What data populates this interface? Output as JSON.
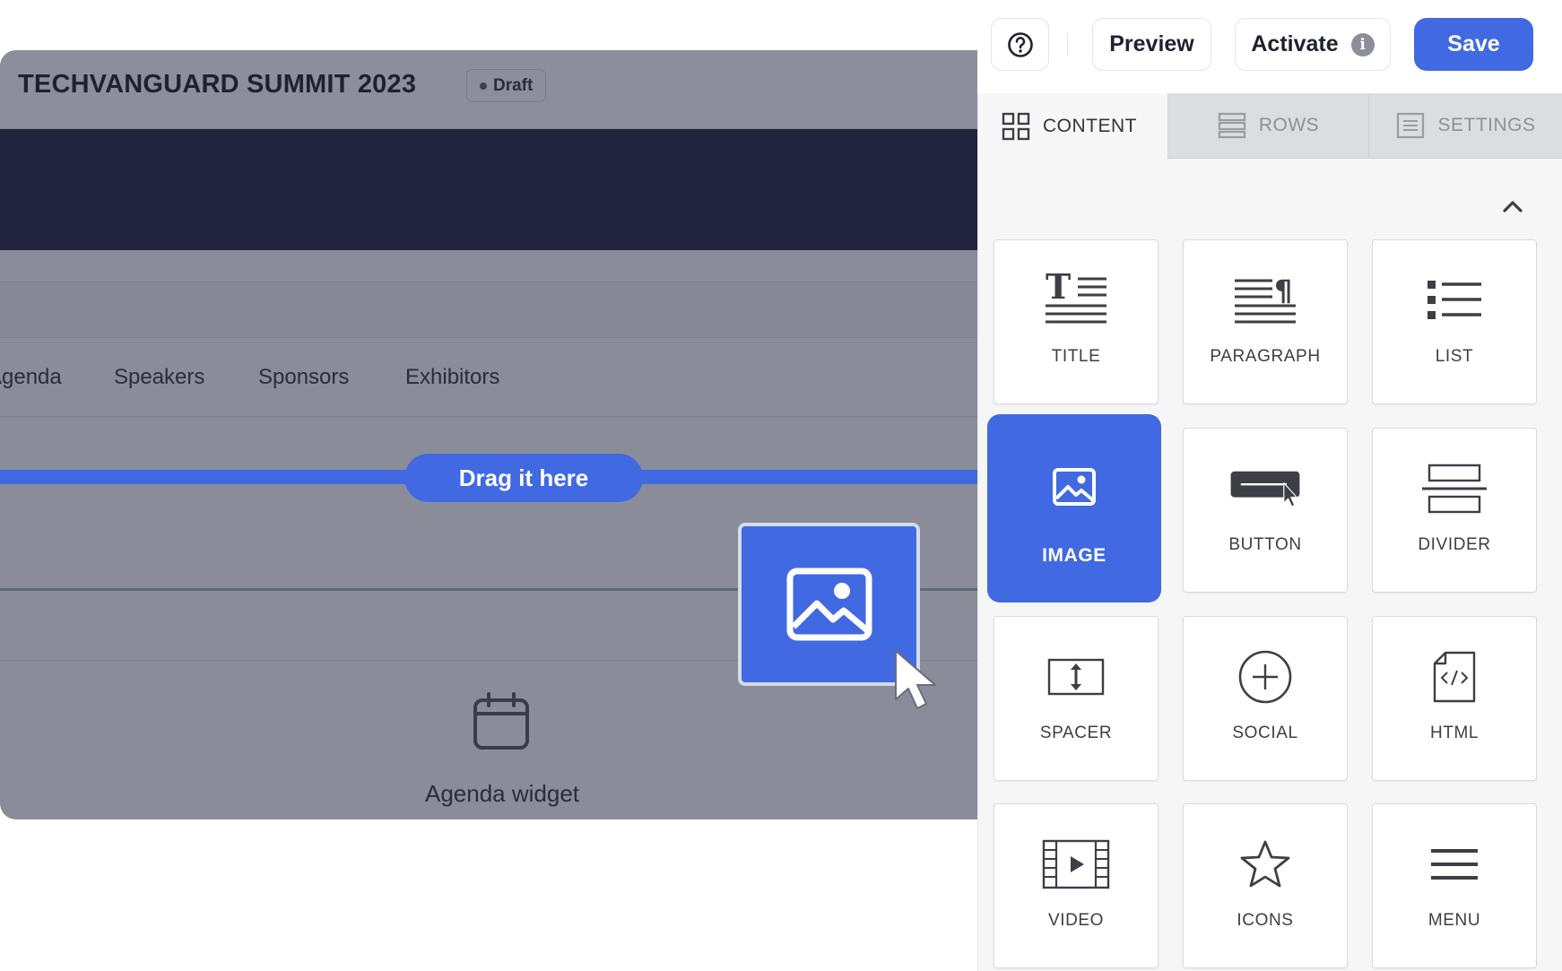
{
  "canvas": {
    "title": "TECHVANGUARD SUMMIT 2023",
    "status": "Draft",
    "nav": [
      "Agenda",
      "Speakers",
      "Sponsors",
      "Exhibitors"
    ],
    "drop_hint": "Drag it here",
    "agenda_widget_label": "Agenda widget"
  },
  "topbar": {
    "preview_label": "Preview",
    "activate_label": "Activate",
    "info_glyph": "i",
    "save_label": "Save"
  },
  "panel": {
    "tabs": [
      {
        "label": "CONTENT",
        "icon": "grid-icon",
        "active": true
      },
      {
        "label": "ROWS",
        "icon": "rows-icon",
        "active": false
      },
      {
        "label": "SETTINGS",
        "icon": "settings-list-icon",
        "active": false
      }
    ],
    "tiles": [
      {
        "label": "TITLE",
        "icon": "title-icon"
      },
      {
        "label": "PARAGRAPH",
        "icon": "paragraph-icon"
      },
      {
        "label": "LIST",
        "icon": "list-icon"
      },
      {
        "label": "IMAGE",
        "icon": "image-icon",
        "active": true
      },
      {
        "label": "BUTTON",
        "icon": "button-icon"
      },
      {
        "label": "DIVIDER",
        "icon": "divider-icon"
      },
      {
        "label": "SPACER",
        "icon": "spacer-icon"
      },
      {
        "label": "SOCIAL",
        "icon": "social-icon"
      },
      {
        "label": "HTML",
        "icon": "html-icon"
      },
      {
        "label": "VIDEO",
        "icon": "video-icon"
      },
      {
        "label": "ICONS",
        "icon": "star-icon"
      },
      {
        "label": "MENU",
        "icon": "menu-icon"
      }
    ]
  },
  "colors": {
    "accent": "#4169e1",
    "overlay": "#8a8d99",
    "hero": "#22243d"
  }
}
